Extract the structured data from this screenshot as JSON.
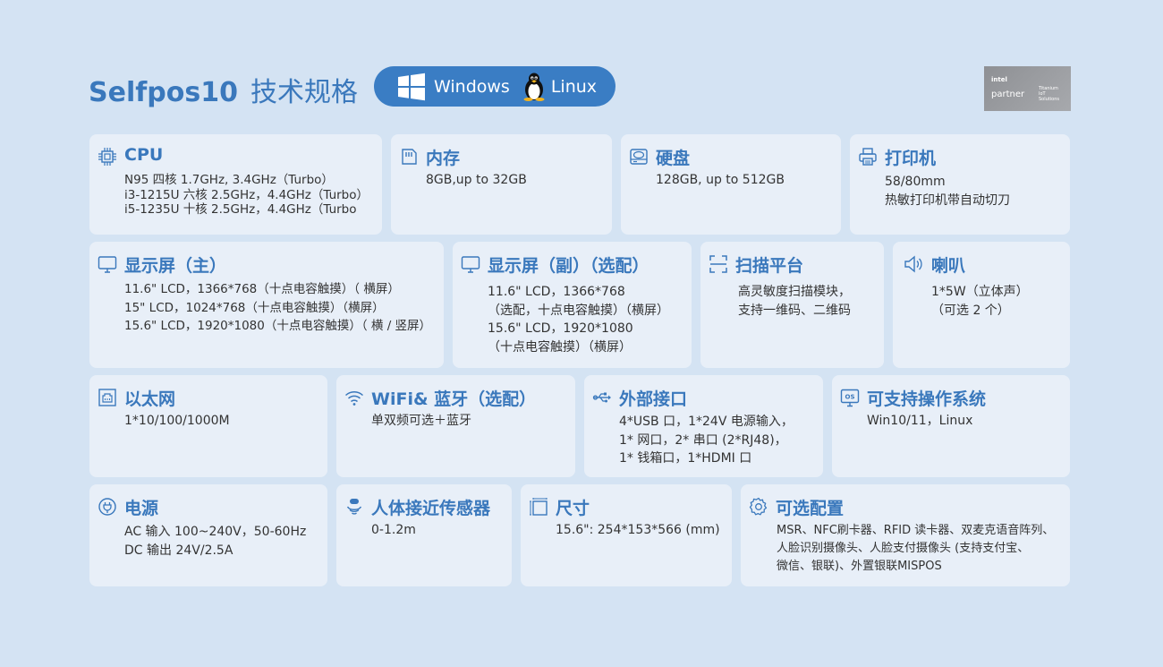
{
  "header": {
    "product": "Selfpos10",
    "subtitle": "技术规格",
    "os_windows": "Windows",
    "os_linux": "Linux",
    "partner_brand": "intel",
    "partner_word": "partner",
    "partner_tier": [
      "Titanium",
      "IoT",
      "Solutions"
    ]
  },
  "colors": {
    "accent": "#3a78bc",
    "background": "#d4e3f3",
    "card": "#e8eff8",
    "pill": "#3a7dc4"
  },
  "specs": {
    "cpu": {
      "icon": "cpu-chip-icon",
      "title": "CPU",
      "lines": [
        "N95 四核 1.7GHz, 3.4GHz（Turbo）",
        "i3-1215U 六核 2.5GHz，4.4GHz（Turbo）",
        "i5-1235U 十核 2.5GHz，4.4GHz（Turbo"
      ]
    },
    "memory": {
      "icon": "memory-card-icon",
      "title": "内存",
      "lines": [
        "8GB,up to 32GB"
      ]
    },
    "disk": {
      "icon": "hard-disk-icon",
      "title": "硬盘",
      "lines": [
        "128GB, up to 512GB"
      ]
    },
    "printer": {
      "icon": "printer-icon",
      "title": "打印机",
      "lines": [
        "58/80mm",
        "热敏打印机带自动切刀"
      ]
    },
    "display_main": {
      "icon": "monitor-icon",
      "title": "显示屏（主）",
      "lines": [
        "11.6\" LCD，1366*768（十点电容触摸）（ 横屏）",
        "15\" LCD，1024*768（十点电容触摸）（横屏）",
        "15.6\" LCD，1920*1080（十点电容触摸）（ 横 / 竖屏）"
      ]
    },
    "display_sub": {
      "icon": "monitor-icon",
      "title": "显示屏（副）（选配）",
      "lines": [
        "11.6\" LCD，1366*768",
        "（选配，十点电容触摸）（横屏）",
        "15.6\" LCD，1920*1080",
        "（十点电容触摸）（横屏）"
      ]
    },
    "scanner": {
      "icon": "scan-frame-icon",
      "title": "扫描平台",
      "lines": [
        "高灵敏度扫描模块，",
        "支持一维码、二维码"
      ]
    },
    "speaker": {
      "icon": "speaker-icon",
      "title": "喇叭",
      "lines": [
        "1*5W（立体声）",
        "（可选 2 个）"
      ]
    },
    "ethernet": {
      "icon": "ethernet-port-icon",
      "title": "以太网",
      "lines": [
        "1*10/100/1000M"
      ]
    },
    "wifi": {
      "icon": "wifi-icon",
      "title": "WiFi& 蓝牙（选配）",
      "lines": [
        "单双频可选＋蓝牙"
      ]
    },
    "ports": {
      "icon": "usb-icon",
      "title": "外部接口",
      "lines": [
        "4*USB 口，1*24V 电源输入，",
        "1* 网口，2* 串口 (2*RJ48)，",
        "1* 钱箱口，1*HDMI 口"
      ]
    },
    "os": {
      "icon": "os-monitor-icon",
      "title": "可支持操作系统",
      "lines": [
        "Win10/11，Linux"
      ]
    },
    "power": {
      "icon": "power-plug-icon",
      "title": "电源",
      "lines": [
        "AC 输入 100~240V，50-60Hz",
        "DC 输出 24V/2.5A"
      ]
    },
    "sensor": {
      "icon": "proximity-sensor-icon",
      "title": "人体接近传感器",
      "lines": [
        "0-1.2m"
      ]
    },
    "size": {
      "icon": "dimension-icon",
      "title": "尺寸",
      "lines": [
        "15.6\": 254*153*566 (mm)"
      ]
    },
    "options": {
      "icon": "gear-icon",
      "title": "可选配置",
      "lines": [
        "MSR、NFC刷卡器、RFID 读卡器、双麦克语音阵列、",
        "人脸识别摄像头、人脸支付摄像头 (支持支付宝、",
        "微信、银联)、外置银联MISPOS"
      ]
    }
  }
}
